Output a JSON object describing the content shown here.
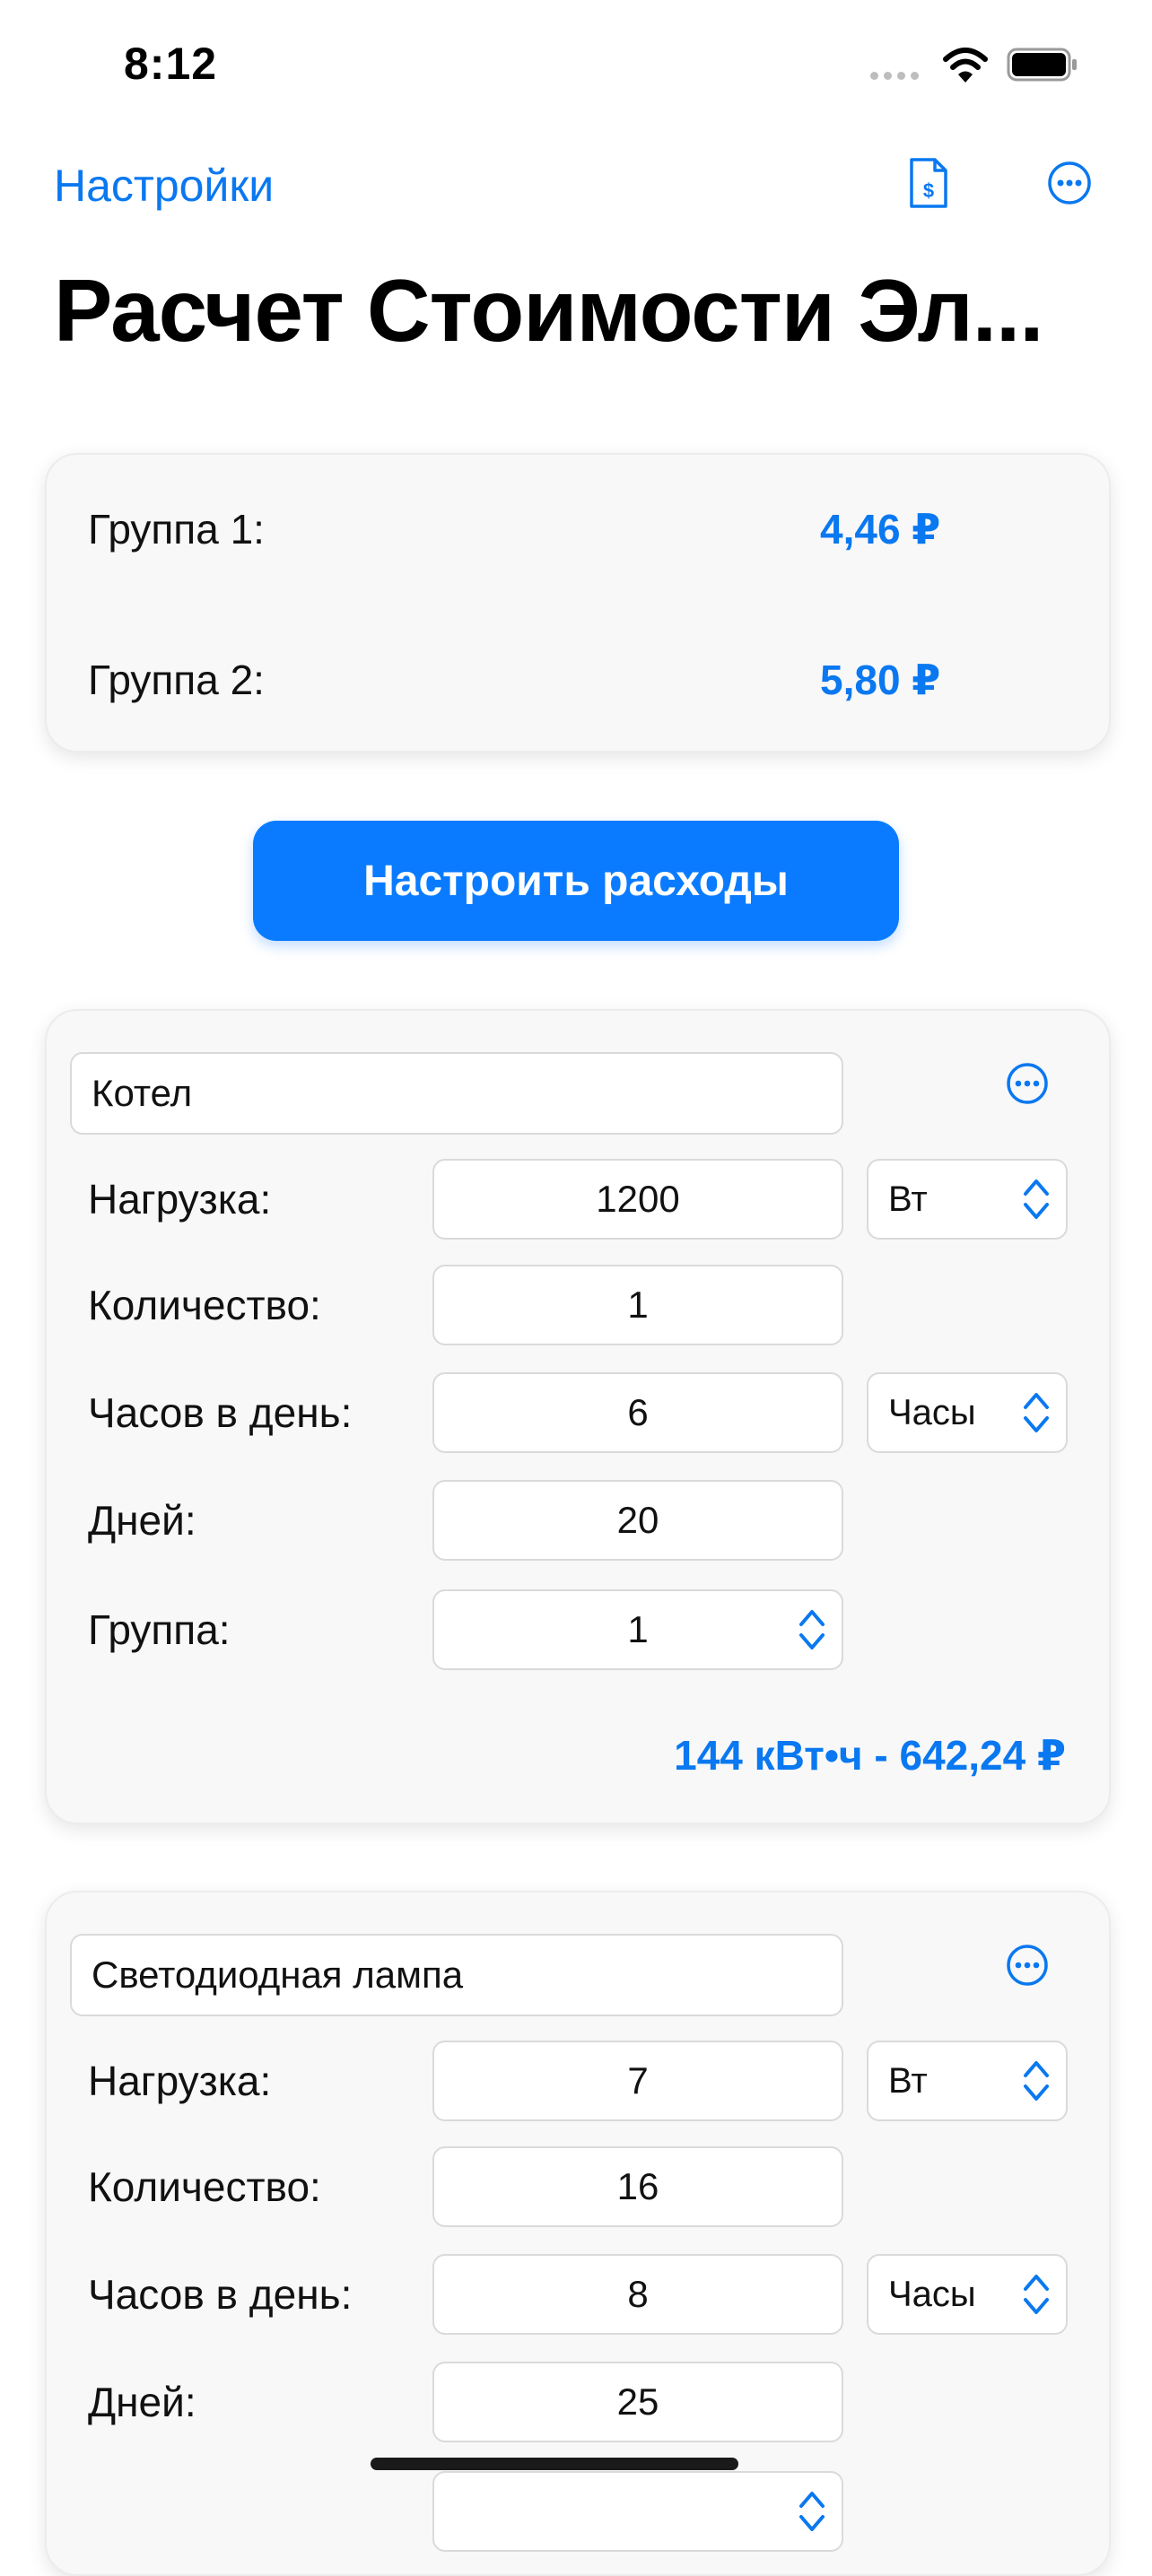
{
  "status_bar": {
    "time": "8:12"
  },
  "nav": {
    "back_label": "Настройки",
    "title": "Расчет Стоимости Эл..."
  },
  "groups": [
    {
      "label": "Группа 1:",
      "price": "4,46 ₽"
    },
    {
      "label": "Группа 2:",
      "price": "5,80 ₽"
    }
  ],
  "configure_button": "Настроить расходы",
  "devices": [
    {
      "name": "Котел",
      "load_label": "Нагрузка:",
      "load": "1200",
      "load_unit": "Вт",
      "qty_label": "Количество:",
      "qty": "1",
      "hours_label": "Часов в день:",
      "hours": "6",
      "hours_unit": "Часы",
      "days_label": "Дней:",
      "days": "20",
      "group_label": "Группа:",
      "group": "1",
      "total": "144 кВт•ч - 642,24 ₽"
    },
    {
      "name": "Светодиодная лампа",
      "load_label": "Нагрузка:",
      "load": "7",
      "load_unit": "Вт",
      "qty_label": "Количество:",
      "qty": "16",
      "hours_label": "Часов в день:",
      "hours": "8",
      "hours_unit": "Часы",
      "days_label": "Дней:",
      "days": "25"
    }
  ],
  "colors": {
    "accent": "#0a78f0",
    "button": "#0a7bff",
    "card_bg": "#f8f8f8"
  }
}
